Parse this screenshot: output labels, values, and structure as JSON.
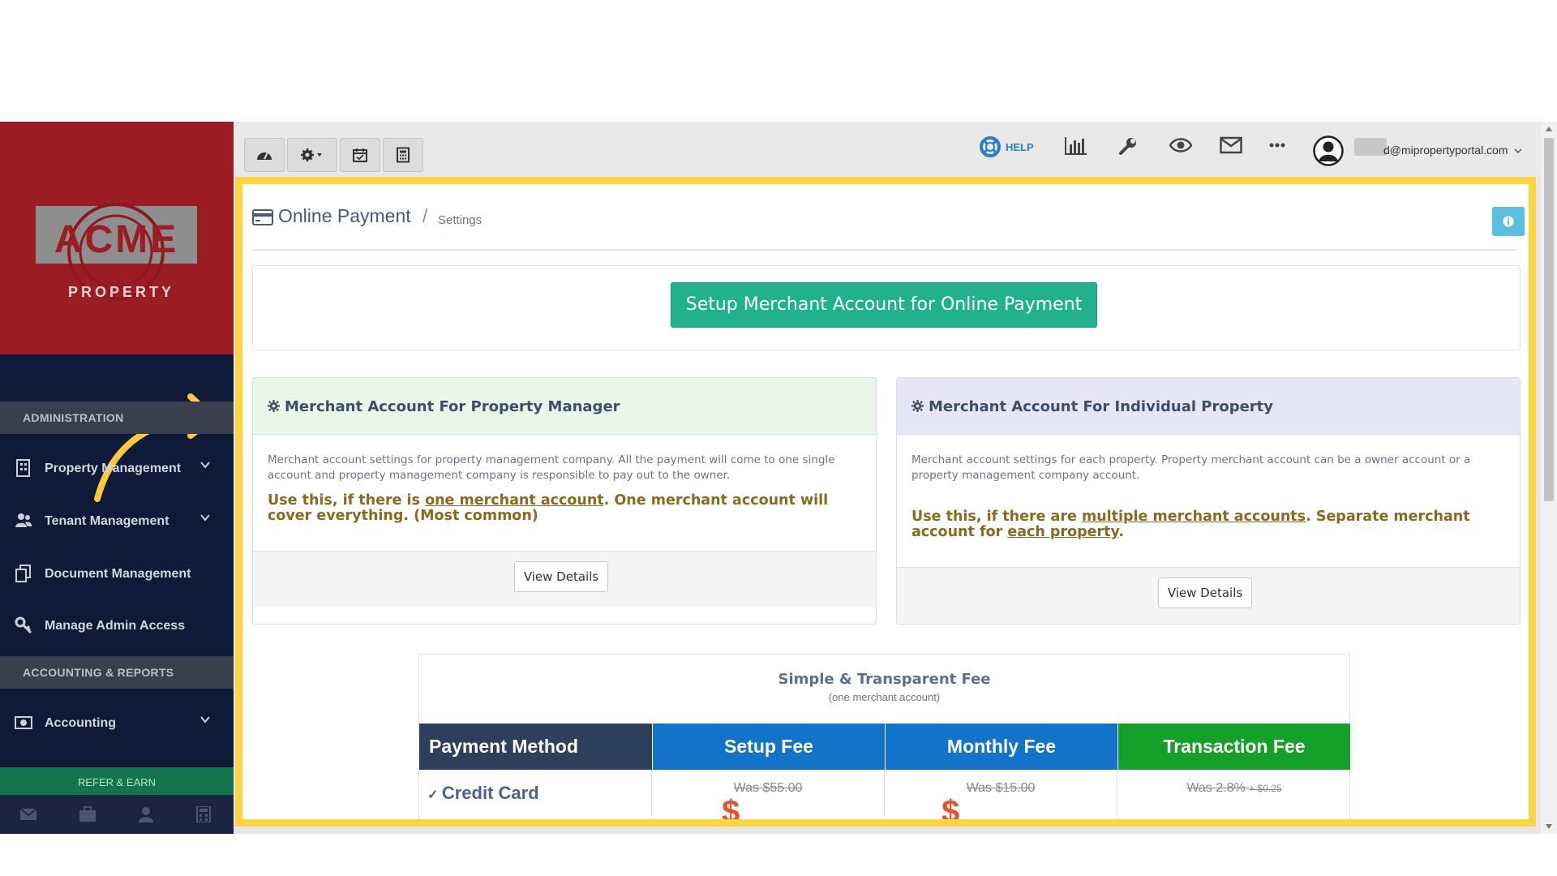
{
  "sidebar": {
    "logo": {
      "brand": "ACME",
      "subtitle": "PROPERTY"
    },
    "sections": [
      {
        "label": "ADMINISTRATION"
      },
      {
        "label": "ACCOUNTING & REPORTS"
      }
    ],
    "items": [
      {
        "label": "Property Management",
        "icon": "building-icon",
        "expandable": true
      },
      {
        "label": "Tenant Management",
        "icon": "users-icon",
        "expandable": true
      },
      {
        "label": "Document Management",
        "icon": "documents-icon",
        "expandable": false
      },
      {
        "label": "Manage Admin Access",
        "icon": "key-icon",
        "expandable": false
      },
      {
        "label": "Accounting",
        "icon": "money-icon",
        "expandable": true
      }
    ],
    "refer_label": "REFER & EARN",
    "bottom_icons": [
      "envelope-icon",
      "briefcase-icon",
      "user-icon",
      "calculator-icon"
    ]
  },
  "topbar": {
    "left_buttons": [
      "dashboard-icon",
      "settings-icon",
      "calendar-icon",
      "calculator-icon"
    ],
    "help_label": "HELP",
    "right_icons": [
      "chart-icon",
      "wrench-icon",
      "eye-icon",
      "envelope-icon",
      "more-icon"
    ],
    "user_email": "d@mipropertyportal.com"
  },
  "page": {
    "title": "Online Payment",
    "breadcrumb": "Settings",
    "setup_button": "Setup Merchant Account for Online Payment",
    "cards": [
      {
        "title": "Merchant Account For Property Manager",
        "description": "Merchant account settings for property management company. All the payment will come to one single account and property management company is responsible to pay out to the owner.",
        "use_prefix": "Use this, if there is ",
        "use_link": "one merchant account",
        "use_suffix": ". One merchant account will cover everything. (Most common)",
        "button": "View Details",
        "header_color": "#e9f7e9"
      },
      {
        "title": "Merchant Account For Individual Property",
        "description": "Merchant account settings for each property. Property merchant account can be a owner account or a property management company account.",
        "use_prefix": "Use this, if there are ",
        "use_link": "multiple merchant accounts",
        "use_middle": ". Separate merchant account for ",
        "use_link2": "each property",
        "use_suffix": ".",
        "button": "View Details",
        "header_color": "#e6e6f7"
      }
    ],
    "fees": {
      "title": "Simple & Transparent Fee",
      "subtitle": "(one merchant account)",
      "columns": [
        {
          "label": "Payment Method",
          "color": "#2e3f5c"
        },
        {
          "label": "Setup Fee",
          "color": "#1273c8"
        },
        {
          "label": "Monthly Fee",
          "color": "#1273c8"
        },
        {
          "label": "Transaction Fee",
          "color": "#14a02a"
        }
      ],
      "row": {
        "method": "Credit Card",
        "setup_was": "Was $55.00",
        "monthly_was": "Was $15.00",
        "transaction_was": "Was 2.8%",
        "transaction_was_extra": "+ $0.25"
      }
    }
  },
  "colors": {
    "highlight": "#ffd640",
    "accent_green": "#21b28d",
    "sidebar_bg": "#0f1a38",
    "logo_bg": "#9c1c23"
  }
}
